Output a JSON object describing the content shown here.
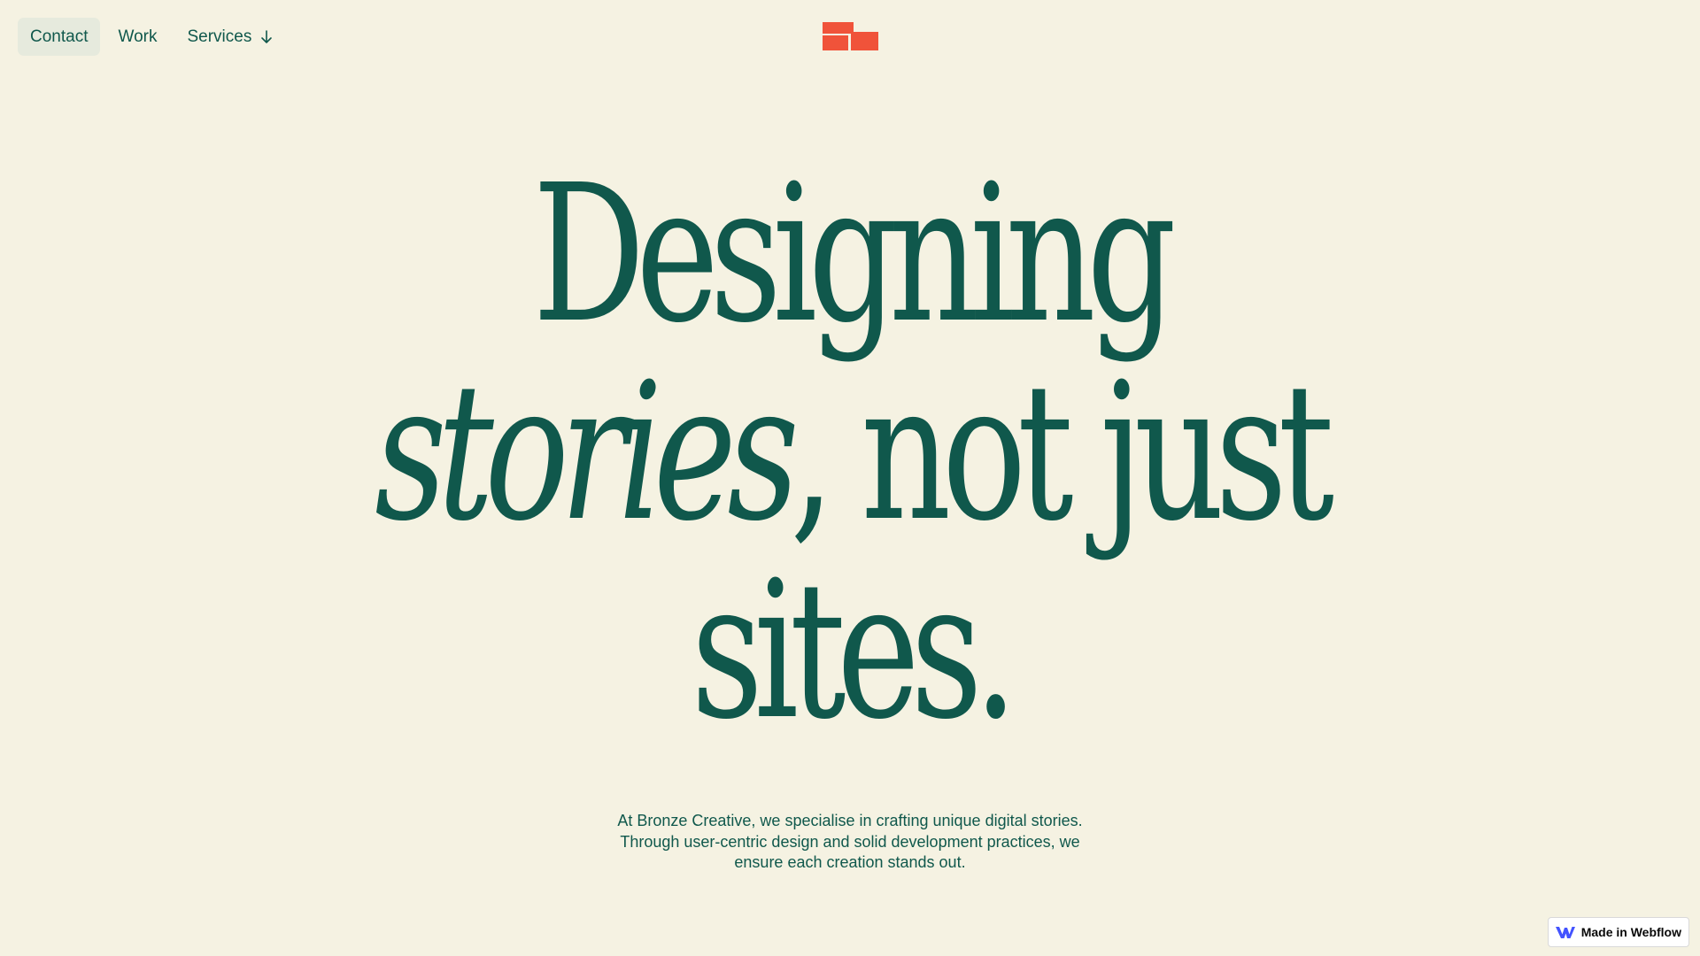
{
  "nav": {
    "items": [
      {
        "label": "Contact",
        "active": true
      },
      {
        "label": "Work",
        "active": false
      },
      {
        "label": "Services",
        "active": false,
        "icon": "arrow-down-icon"
      }
    ]
  },
  "logo": {
    "icon": "bronze-creative-logo",
    "color": "#f0533a"
  },
  "hero": {
    "line1": "Designing",
    "line2_italic": "stories",
    "line2_rest": ", not just",
    "line3": "sites."
  },
  "description": {
    "text": "At Bronze Creative, we specialise in crafting unique digital stories. Through user-centric design and solid development practices, we ensure each creation stands out."
  },
  "badge": {
    "label": "Made in Webflow",
    "icon": "webflow-icon",
    "icon_color": "#4353ff"
  },
  "colors": {
    "background": "#f5f2e2",
    "text": "#10584c",
    "accent": "#f0533a",
    "active_nav_bg": "#e6eadd"
  }
}
